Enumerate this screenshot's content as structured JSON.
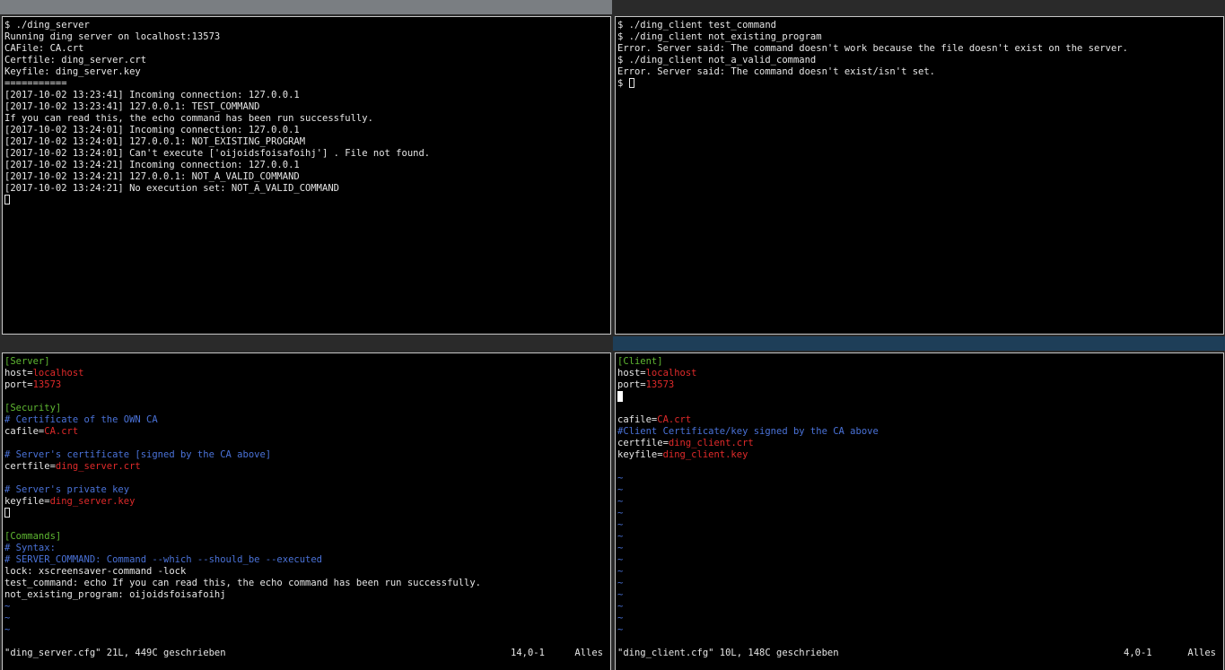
{
  "colors": {
    "background": "#000000",
    "text": "#e6e6e6",
    "section": "#5fb832",
    "value": "#e02a2a",
    "comment": "#4a72d8",
    "active_tab": "#7a7e82",
    "active_vim_tab": "#1e3e58"
  },
  "server_terminal": {
    "lines": [
      "$ ./ding_server",
      "Running ding server on localhost:13573",
      "CAFile: CA.crt",
      "Certfile: ding_server.crt",
      "Keyfile: ding_server.key",
      "===========",
      "[2017-10-02 13:23:41] Incoming connection: 127.0.0.1",
      "[2017-10-02 13:23:41] 127.0.0.1: TEST_COMMAND",
      "If you can read this, the echo command has been run successfully.",
      "[2017-10-02 13:24:01] Incoming connection: 127.0.0.1",
      "[2017-10-02 13:24:01] 127.0.0.1: NOT_EXISTING_PROGRAM",
      "[2017-10-02 13:24:01] Can't execute ['oijoidsfoisafoihj'] . File not found.",
      "[2017-10-02 13:24:21] Incoming connection: 127.0.0.1",
      "[2017-10-02 13:24:21] 127.0.0.1: NOT_A_VALID_COMMAND",
      "[2017-10-02 13:24:21] No execution set: NOT_A_VALID_COMMAND"
    ]
  },
  "client_terminal": {
    "lines": [
      "$ ./ding_client test_command",
      "$ ./ding_client not_existing_program",
      "Error. Server said: The command doesn't work because the file doesn't exist on the server.",
      "$ ./ding_client not_a_valid_command",
      "Error. Server said: The command doesn't exist/isn't set."
    ],
    "prompt": "$ "
  },
  "server_cfg": {
    "section_server": "[Server]",
    "host_key": "host=",
    "host_value": "localhost",
    "port_key": "port=",
    "port_value": "13573",
    "section_security": "[Security]",
    "comment_own_ca": "# Certificate of the OWN CA",
    "cafile_key": "cafile=",
    "cafile_value": "CA.crt",
    "comment_server_cert": "# Server's certificate [signed by the CA above]",
    "certfile_key": "certfile=",
    "certfile_value": "ding_server.crt",
    "comment_private_key": "# Server's private key",
    "keyfile_key": "keyfile=",
    "keyfile_value": "ding_server.key",
    "section_commands": "[Commands]",
    "comment_syntax": "# Syntax:",
    "comment_syntax_example": "# SERVER_COMMAND: Command --which --should_be --executed",
    "cmd_lock": "lock: xscreensaver-command -lock",
    "cmd_test": "test_command: echo If you can read this, the echo command has been run successfully.",
    "cmd_not_existing": "not_existing_program: oijoidsfoisafoihj",
    "tilde": "~",
    "status_message": "\"ding_server.cfg\" 21L, 449C geschrieben",
    "status_position": "14,0-1",
    "status_scroll": "Alles"
  },
  "client_cfg": {
    "section_client": "[Client]",
    "host_key": "host=",
    "host_value": "localhost",
    "port_key": "port=",
    "port_value": "13573",
    "cafile_key": "cafile=",
    "cafile_value": "CA.crt",
    "comment_client_cert": "#Client Certificate/key signed by the CA above",
    "certfile_key": "certfile=",
    "certfile_value": "ding_client.crt",
    "keyfile_key": "keyfile=",
    "keyfile_value": "ding_client.key",
    "tilde": "~",
    "status_message": "\"ding_client.cfg\" 10L, 148C geschrieben",
    "status_position": "4,0-1",
    "status_scroll": "Alles"
  }
}
